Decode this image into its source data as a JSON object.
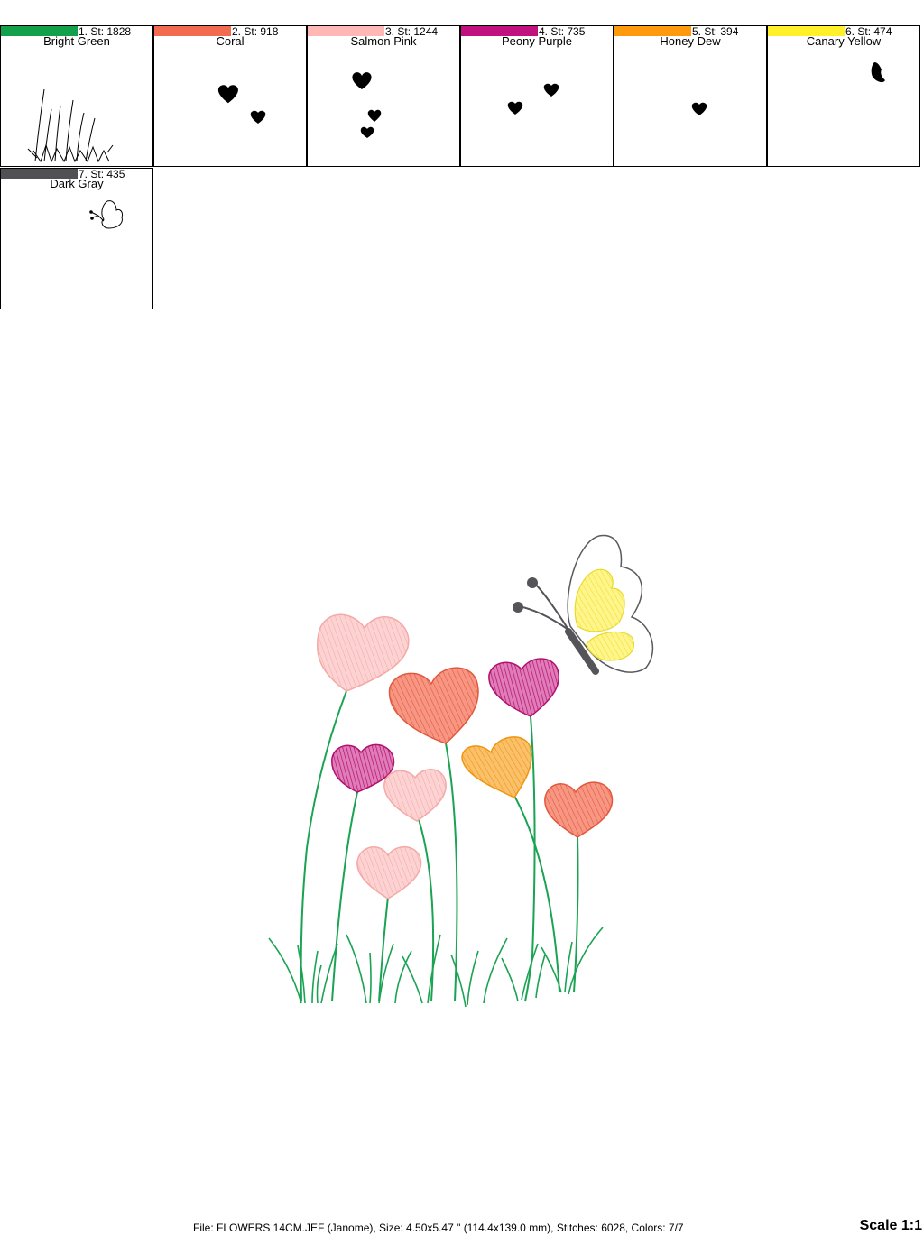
{
  "colors": [
    {
      "index": "1.",
      "stitches_label": "St: 1828",
      "name": "Bright Green",
      "hex": "#12a04a"
    },
    {
      "index": "2.",
      "stitches_label": "St: 918",
      "name": "Coral",
      "hex": "#f26a50"
    },
    {
      "index": "3.",
      "stitches_label": "St: 1244",
      "name": "Salmon Pink",
      "hex": "#ffb8b5"
    },
    {
      "index": "4.",
      "stitches_label": "St: 735",
      "name": "Peony Purple",
      "hex": "#c0117e"
    },
    {
      "index": "5.",
      "stitches_label": "St: 394",
      "name": "Honey Dew",
      "hex": "#ff9a0d"
    },
    {
      "index": "6.",
      "stitches_label": "St: 474",
      "name": "Canary Yellow",
      "hex": "#fff02a"
    },
    {
      "index": "7.",
      "stitches_label": "St: 435",
      "name": "Dark Gray",
      "hex": "#505055"
    }
  ],
  "footer": {
    "file_info": "File: FLOWERS 14CM.JEF (Janome), Size: 4.50x5.47 \" (114.4x139.0 mm), Stitches: 6028, Colors: 7/7",
    "scale": "Scale 1:1"
  }
}
